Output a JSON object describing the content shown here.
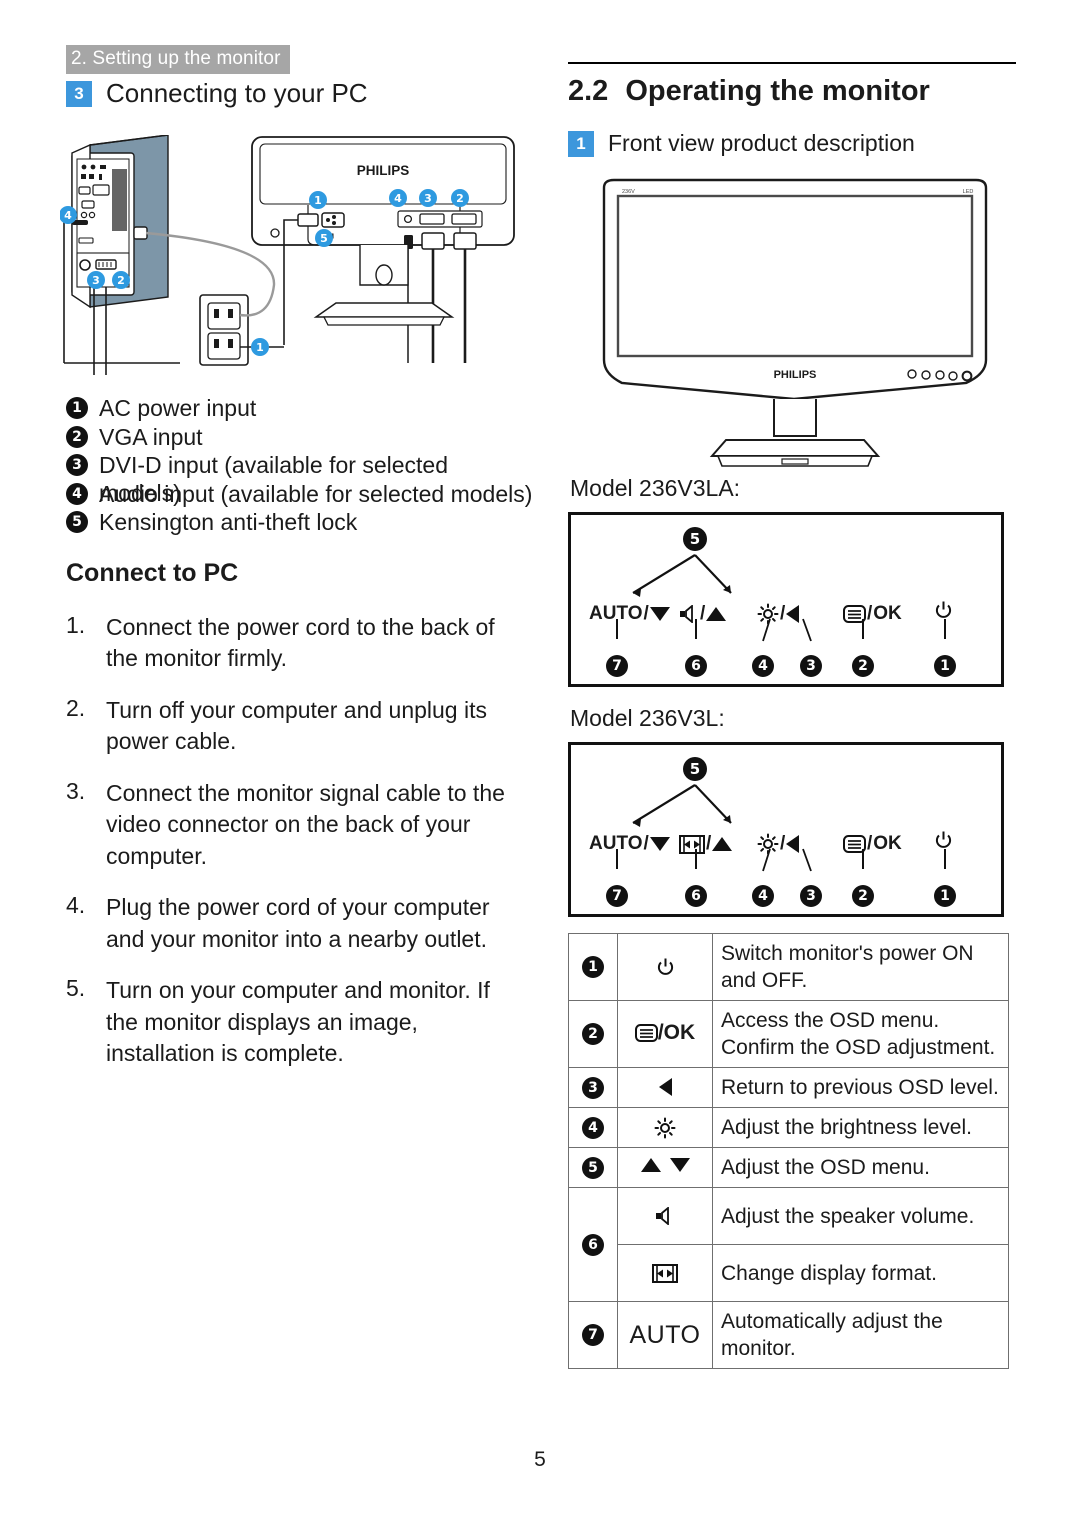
{
  "running_head": "2. Setting up the monitor",
  "left": {
    "section": {
      "badge": "3",
      "title": "Connecting to your PC"
    },
    "diagram": {
      "monitor_brand": "PHILIPS",
      "callouts": [
        "1",
        "2",
        "3",
        "4",
        "5"
      ]
    },
    "legend": [
      {
        "num": "1",
        "text": "AC power input"
      },
      {
        "num": "2",
        "text": "VGA input"
      },
      {
        "num": "3",
        "text": "DVI-D input (available for selected models)"
      },
      {
        "num": "4",
        "text": "Audio input (available for selected models)"
      },
      {
        "num": "5",
        "text": "Kensington anti-theft lock"
      }
    ],
    "connect_heading": "Connect to PC",
    "steps": [
      {
        "num": "1.",
        "text": "Connect the power cord to the back of the monitor firmly."
      },
      {
        "num": "2.",
        "text": "Turn off your computer and unplug its power cable."
      },
      {
        "num": "3.",
        "text": "Connect the monitor signal cable to the video connector on the back of your computer."
      },
      {
        "num": "4.",
        "text": "Plug the power cord of your computer and your monitor into a nearby outlet."
      },
      {
        "num": "5.",
        "text": "Turn on your computer and monitor. If the monitor displays an image,  installation is complete."
      }
    ]
  },
  "right": {
    "h2_number": "2.2",
    "h2_title": "Operating the monitor",
    "section": {
      "badge": "1",
      "title": "Front view product description"
    },
    "front_view": {
      "bezel_top_left": "236V",
      "bezel_top_right": "LED",
      "brand": "PHILIPS"
    },
    "panels": [
      {
        "label": "Model 236V3LA:",
        "group_badge": "5",
        "buttons": [
          {
            "num": "7",
            "label": "AUTO",
            "slash": "/",
            "icon": "down-arrow-icon"
          },
          {
            "num": "6",
            "label": "",
            "slash": "/",
            "icon": "speaker-icon",
            "icon2": "up-arrow-icon"
          },
          {
            "num": "4",
            "label": "",
            "slash": "/",
            "icon": "brightness-icon",
            "icon2": "left-arrow-icon"
          },
          {
            "num": "3",
            "label": "",
            "icon": "left-arrow-icon"
          },
          {
            "num": "2",
            "label": "OK",
            "slash": "/",
            "icon": "menu-icon"
          },
          {
            "num": "1",
            "label": "",
            "icon": "power-icon"
          }
        ]
      },
      {
        "label": "Model 236V3L:",
        "group_badge": "5",
        "buttons": [
          {
            "num": "7",
            "label": "AUTO",
            "slash": "/",
            "icon": "down-arrow-icon"
          },
          {
            "num": "6",
            "label": "",
            "slash": "/",
            "icon": "display-format-icon",
            "icon2": "up-arrow-icon"
          },
          {
            "num": "4",
            "label": "",
            "slash": "/",
            "icon": "brightness-icon",
            "icon2": "left-arrow-icon"
          },
          {
            "num": "3",
            "label": "",
            "icon": "left-arrow-icon"
          },
          {
            "num": "2",
            "label": "OK",
            "slash": "/",
            "icon": "menu-icon"
          },
          {
            "num": "1",
            "label": "",
            "icon": "power-icon"
          }
        ]
      }
    ],
    "function_table": [
      {
        "num": "1",
        "icon": "power-icon",
        "icon_text": "",
        "desc": "Switch monitor's power ON and OFF."
      },
      {
        "num": "2",
        "icon": "menu-icon",
        "icon_text": "/OK",
        "desc": "Access the OSD menu.\nConfirm the OSD adjustment."
      },
      {
        "num": "3",
        "icon": "left-arrow-icon",
        "icon_text": "",
        "desc": "Return to previous OSD level."
      },
      {
        "num": "4",
        "icon": "brightness-icon",
        "icon_text": "",
        "desc": "Adjust the brightness level."
      },
      {
        "num": "5",
        "icon": "up-down-arrows-icon",
        "icon_text": "",
        "desc": "Adjust the OSD menu."
      },
      {
        "num": "6",
        "icon": "speaker-icon",
        "icon_text": "",
        "desc": "Adjust the speaker volume.",
        "rowspan": true
      },
      {
        "num": "",
        "icon": "display-format-icon",
        "icon_text": "",
        "desc": "Change display format."
      },
      {
        "num": "7",
        "icon": "auto-text-icon",
        "icon_text": "AUTO",
        "desc": "Automatically adjust the monitor."
      }
    ]
  },
  "page_number": "5",
  "colors": {
    "badge_blue": "#3d97dc",
    "head_gray": "#a6a6a6",
    "callout_blue": "#2e9ae0",
    "pc_side": "#7d96a8"
  }
}
